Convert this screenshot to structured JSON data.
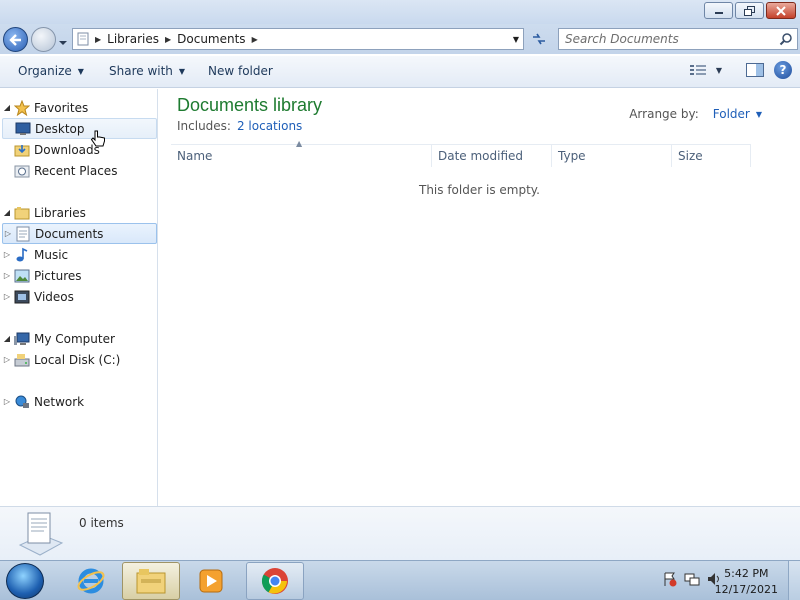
{
  "window": {
    "minimize_icon": "minimize-icon",
    "maximize_icon": "restore-icon",
    "close_icon": "close-icon"
  },
  "address_bar": {
    "crumbs": [
      "Libraries",
      "Documents"
    ],
    "search_placeholder": "Search Documents"
  },
  "toolbar": {
    "organize_label": "Organize",
    "share_label": "Share with",
    "new_folder_label": "New folder"
  },
  "nav": {
    "favorites": {
      "label": "Favorites",
      "items": [
        "Desktop",
        "Downloads",
        "Recent Places"
      ]
    },
    "libraries": {
      "label": "Libraries",
      "items": [
        "Documents",
        "Music",
        "Pictures",
        "Videos"
      ]
    },
    "computer": {
      "label": "My Computer",
      "items": [
        "Local Disk (C:)"
      ]
    },
    "network": {
      "label": "Network"
    }
  },
  "main": {
    "title": "Documents library",
    "includes_label": "Includes:",
    "includes_link": "2 locations",
    "arrange_label": "Arrange by:",
    "arrange_value": "Folder",
    "columns": [
      "Name",
      "Date modified",
      "Type",
      "Size"
    ],
    "empty_message": "This folder is empty."
  },
  "details": {
    "item_count": "0 items"
  },
  "taskbar": {
    "time": "5:42 PM",
    "date": "12/17/2021",
    "apps": [
      "internet-explorer-icon",
      "file-explorer-icon",
      "media-player-icon",
      "chrome-icon"
    ]
  },
  "colors": {
    "title_green": "#1e7b30",
    "link_blue": "#1f5fb8",
    "selection_border": "#9bc2ec"
  }
}
